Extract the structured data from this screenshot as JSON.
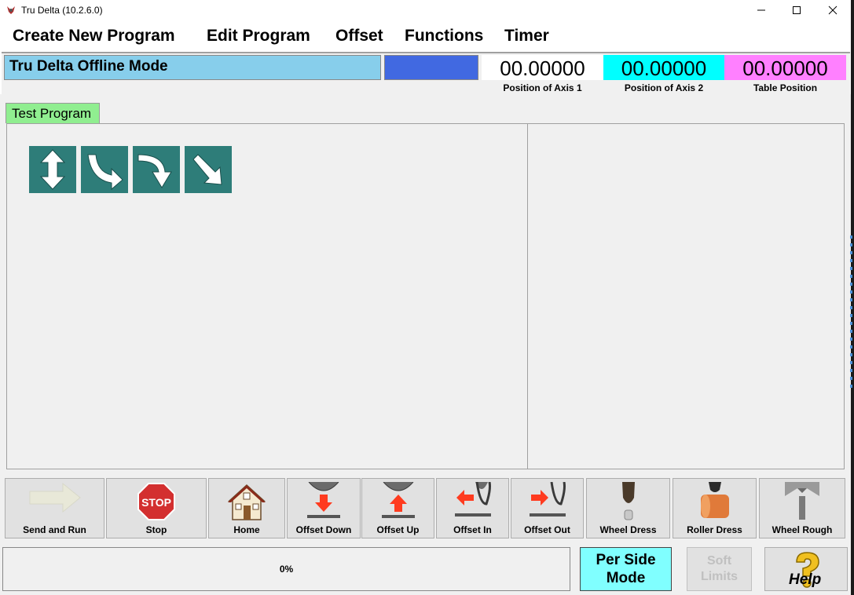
{
  "window": {
    "title": "Tru Delta (10.2.6.0)"
  },
  "menu": {
    "items": [
      {
        "label": "Create New Program"
      },
      {
        "label": "Edit Program"
      },
      {
        "label": "Offset"
      },
      {
        "label": "Functions"
      },
      {
        "label": "Timer"
      }
    ]
  },
  "status": {
    "mode": "Tru Delta Offline Mode",
    "axis1_value": "00.00000",
    "axis1_label": "Position of Axis 1",
    "axis2_value": "00.00000",
    "axis2_label": "Position of Axis 2",
    "table_value": "00.00000",
    "table_label": "Table Position",
    "colors": {
      "mode_bg": "#87ceeb",
      "indicator": "#4169e1",
      "axis2_bg": "#00ffff",
      "table_bg": "#ff80ff"
    }
  },
  "program": {
    "tab_label": "Test Program",
    "steps": [
      {
        "icon": "vertical-arrows-icon"
      },
      {
        "icon": "curve-right-down-arrow-icon"
      },
      {
        "icon": "curve-down-arrow-icon"
      },
      {
        "icon": "diagonal-down-right-arrow-icon"
      }
    ]
  },
  "toolbar": {
    "send_and_run": "Send and Run",
    "stop": "Stop",
    "stop_sign": "STOP",
    "home": "Home",
    "offset_down": "Offset Down",
    "offset_up": "Offset Up",
    "offset_in": "Offset In",
    "offset_out": "Offset Out",
    "wheel_dress": "Wheel Dress",
    "roller_dress": "Roller Dress",
    "wheel_rough": "Wheel Rough"
  },
  "bottom": {
    "progress_value": 0,
    "progress_text": "0%",
    "per_side_line1": "Per Side",
    "per_side_line2": "Mode",
    "soft_limits_line1": "Soft",
    "soft_limits_line2": "Limits",
    "help": "Help"
  }
}
